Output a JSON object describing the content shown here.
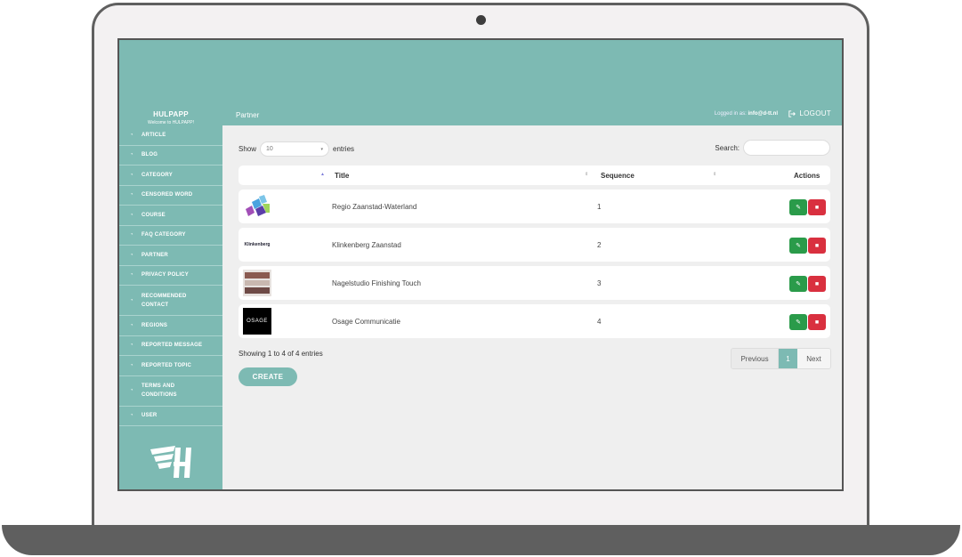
{
  "app": {
    "name": "HULPAPP",
    "welcome": "Welcome to HULPAPP!",
    "page_title": "Partner",
    "logged_in_label": "Logged in as:",
    "logged_in_user": "info@d-tt.nl",
    "logout_label": "LOGOUT"
  },
  "sidebar": {
    "items": [
      {
        "label": "ARTICLE"
      },
      {
        "label": "BLOG"
      },
      {
        "label": "CATEGORY"
      },
      {
        "label": "CENSORED WORD"
      },
      {
        "label": "COURSE"
      },
      {
        "label": "FAQ CATEGORY"
      },
      {
        "label": "PARTNER"
      },
      {
        "label": "PRIVACY POLICY"
      },
      {
        "label": "RECOMMENDED CONTACT"
      },
      {
        "label": "REGIONS"
      },
      {
        "label": "REPORTED MESSAGE"
      },
      {
        "label": "REPORTED TOPIC"
      },
      {
        "label": "TERMS AND CONDITIONS"
      },
      {
        "label": "USER"
      }
    ]
  },
  "table": {
    "show_label": "Show",
    "entries_value": "10",
    "entries_label": "entries",
    "search_label": "Search:",
    "columns": {
      "title": "Title",
      "sequence": "Sequence",
      "actions": "Actions"
    },
    "rows": [
      {
        "title": "Regio Zaanstad-Waterland",
        "sequence": "1",
        "logo": "map-logo"
      },
      {
        "title": "Klinkenberg Zaanstad",
        "sequence": "2",
        "logo": "klinkenberg-logo"
      },
      {
        "title": "Nagelstudio Finishing Touch",
        "sequence": "3",
        "logo": "nails-photo"
      },
      {
        "title": "Osage Communicatie",
        "sequence": "4",
        "logo": "osage-logo"
      }
    ],
    "thumb_text": {
      "klinkenberg": "Klinkenberg",
      "osage": "OSAGE"
    },
    "info": "Showing 1 to 4 of 4 entries",
    "pager": {
      "previous": "Previous",
      "current": "1",
      "next": "Next"
    },
    "create_label": "CREATE"
  },
  "colors": {
    "accent": "#7dbab3",
    "edit": "#2a9b4a",
    "delete": "#d9303f"
  }
}
